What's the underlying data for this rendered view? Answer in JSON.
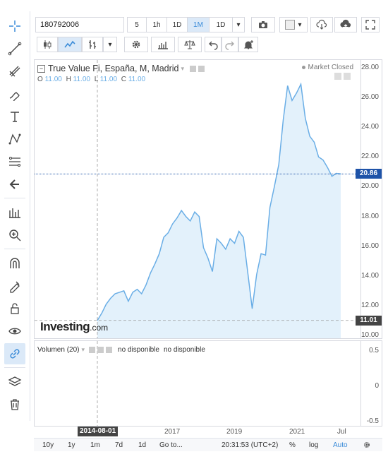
{
  "toolbar": {
    "symbol_value": "180792006",
    "intervals": [
      "5",
      "1h",
      "1D",
      "1M",
      "1D"
    ],
    "active_interval": "1M"
  },
  "legend": {
    "title": "True Value Fi, España, M, Madrid",
    "market_status": "Market Closed",
    "o_label": "O",
    "o_value": "11.00",
    "h_label": "H",
    "h_value": "11.00",
    "l_label": "L",
    "l_value": "11.00",
    "c_label": "C",
    "c_value": "11.00"
  },
  "watermark": {
    "brand": "Investing",
    "suffix": ".com"
  },
  "price_axis": {
    "ticks": [
      "28.00",
      "26.00",
      "24.00",
      "22.00",
      "20.00",
      "18.00",
      "16.00",
      "14.00",
      "12.00",
      "10.00"
    ],
    "current_price": "20.86",
    "low_marker": "11.01"
  },
  "volume": {
    "label": "Volumen (20)",
    "value1": "no disponible",
    "value2": "no disponible",
    "ticks": [
      "0.5",
      "0",
      "-0.5"
    ]
  },
  "time_axis": {
    "cursor_date": "2014-08-01",
    "labels": [
      "2017",
      "2019",
      "2021",
      "Jul"
    ]
  },
  "bottom_bar": {
    "ranges": [
      "10y",
      "1y",
      "1m",
      "7d",
      "1d"
    ],
    "goto": "Go to...",
    "clock": "20:31:53 (UTC+2)",
    "percent": "%",
    "log": "log",
    "auto": "Auto"
  },
  "colors": {
    "accent": "#3a8bd8",
    "line": "#6aaee6",
    "area": "#e3f1fb",
    "price_label_bg": "#1e53a8"
  },
  "chart_data": {
    "type": "area",
    "x": [
      "2014-08",
      "2014-10",
      "2014-12",
      "2015-02",
      "2015-04",
      "2015-06",
      "2015-08",
      "2015-10",
      "2015-12",
      "2016-02",
      "2016-04",
      "2016-06",
      "2016-08",
      "2016-10",
      "2016-12",
      "2017-02",
      "2017-04",
      "2017-06",
      "2017-08",
      "2017-10",
      "2017-12",
      "2018-02",
      "2018-04",
      "2018-06",
      "2018-08",
      "2018-10",
      "2018-12",
      "2019-02",
      "2019-04",
      "2019-06",
      "2019-08",
      "2019-10",
      "2019-12",
      "2020-01",
      "2020-02",
      "2020-03",
      "2020-04",
      "2020-06",
      "2020-08",
      "2020-10",
      "2020-12",
      "2021-02",
      "2021-04",
      "2021-06",
      "2021-08",
      "2021-09",
      "2021-10",
      "2021-11",
      "2021-12",
      "2022-01",
      "2022-02",
      "2022-03",
      "2022-04",
      "2022-05",
      "2022-06",
      "2022-07"
    ],
    "values": [
      11.0,
      11.5,
      12.1,
      12.5,
      12.8,
      12.9,
      13.0,
      12.3,
      12.9,
      13.1,
      12.8,
      13.4,
      14.2,
      14.8,
      15.5,
      16.6,
      16.9,
      17.5,
      17.9,
      18.4,
      18.0,
      17.7,
      18.3,
      18.0,
      15.9,
      15.2,
      14.3,
      16.5,
      16.2,
      15.8,
      16.5,
      16.2,
      17.0,
      16.6,
      14.2,
      11.8,
      14.1,
      15.5,
      15.4,
      18.6,
      20.0,
      21.5,
      24.5,
      26.8,
      25.8,
      26.3,
      26.9,
      24.6,
      23.4,
      23.0,
      22.0,
      21.8,
      21.3,
      20.7,
      20.9,
      20.86
    ],
    "ylim": [
      10,
      28
    ],
    "current": 20.86,
    "low": 11.01
  }
}
